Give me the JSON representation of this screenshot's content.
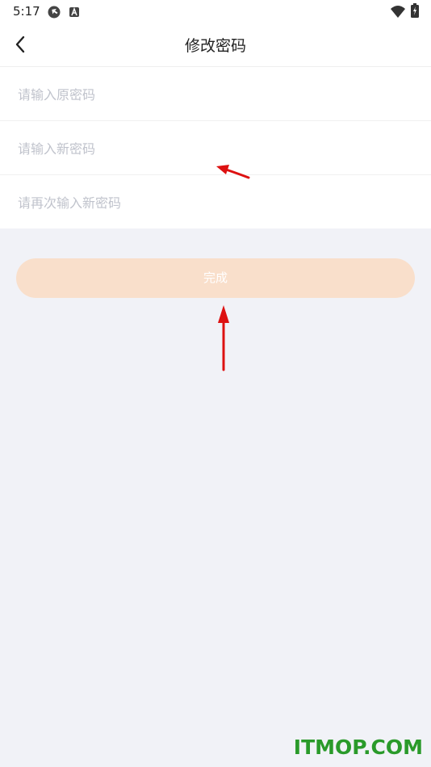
{
  "status_bar": {
    "time": "5:17",
    "icons": [
      "sync-icon",
      "a-badge-icon",
      "wifi-icon",
      "battery-icon"
    ]
  },
  "header": {
    "title": "修改密码",
    "back_icon": "chevron-left-icon"
  },
  "form": {
    "fields": [
      {
        "placeholder": "请输入原密码",
        "value": ""
      },
      {
        "placeholder": "请输入新密码",
        "value": ""
      },
      {
        "placeholder": "请再次输入新密码",
        "value": ""
      }
    ]
  },
  "actions": {
    "done_label": "完成",
    "done_bg": "#f9dfcb"
  },
  "watermark": {
    "text": "ITMOP.COM",
    "color": "#2a9a2a"
  },
  "colors": {
    "page_bg": "#f1f2f7",
    "annotation_arrow": "#dd1111"
  }
}
